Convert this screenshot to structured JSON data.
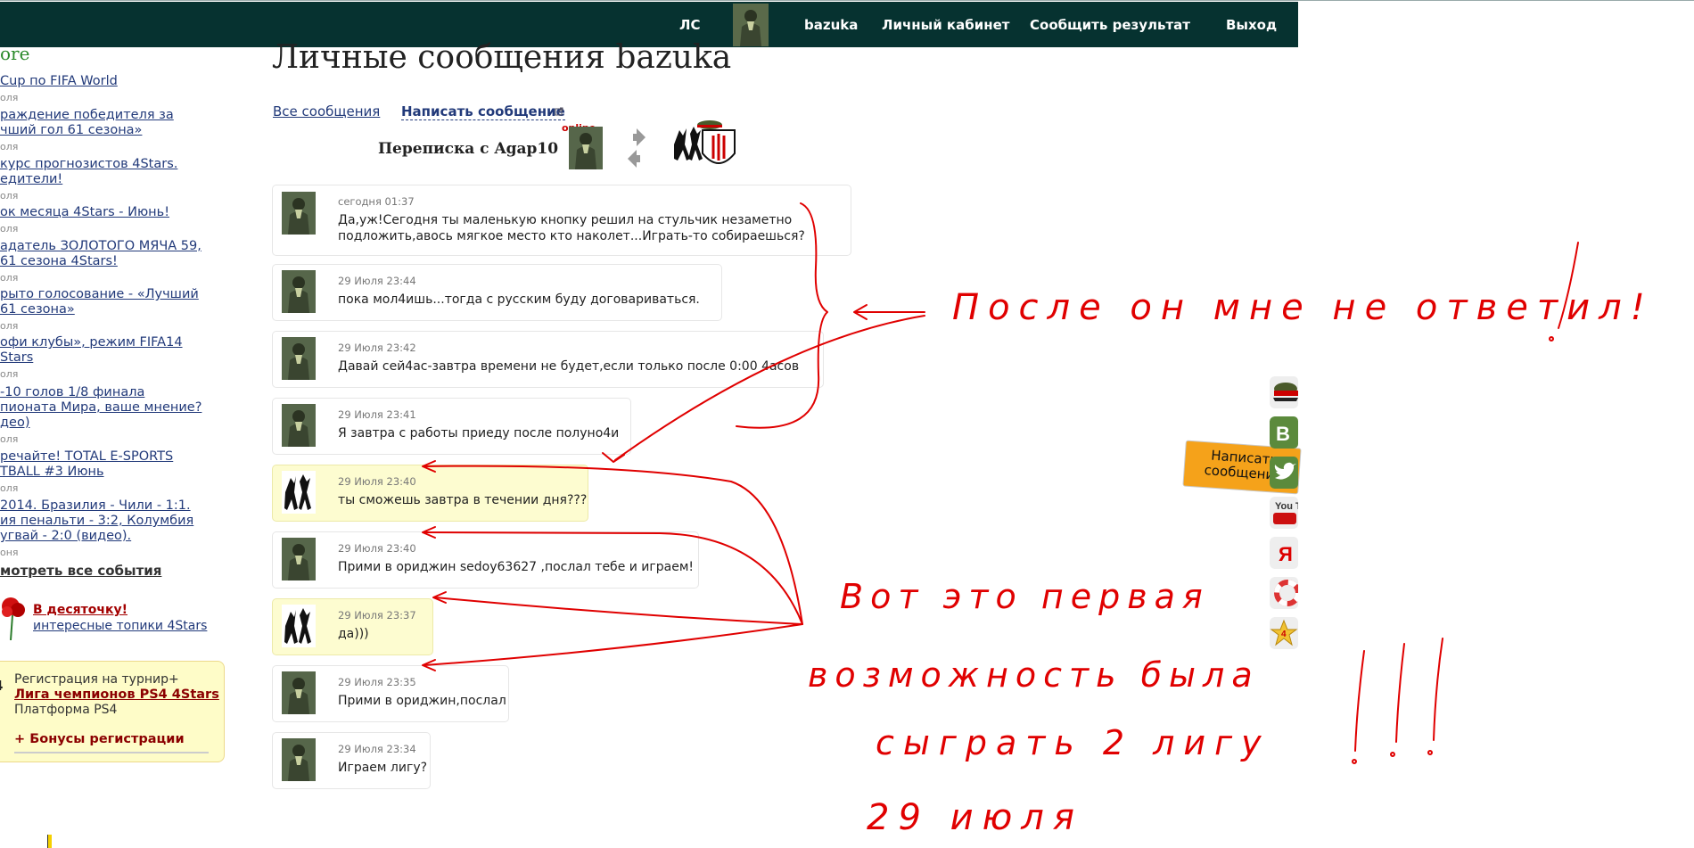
{
  "nav": {
    "ls": "ЛС",
    "user": "bazuka",
    "cabinet": "Личный кабинет",
    "report": "Сообщить результат",
    "logout": "Выход"
  },
  "sidebar": {
    "heading": "ore",
    "events": [
      {
        "title": " Cup по FIFA World",
        "date": "оля"
      },
      {
        "title": "раждение победителя за",
        "title2": "чший гол 61 сезона»",
        "date": "оля"
      },
      {
        "title": "курс прогнозистов 4Stars.",
        "title2": "едители!",
        "date": "оля"
      },
      {
        "title": "ок месяца 4Stars - Июнь!",
        "date": "оля"
      },
      {
        "title": "адатель ЗОЛОТОГО МЯЧА 59,",
        "title2": " 61 сезона 4Stars!",
        "date": "оля"
      },
      {
        "title": "рыто голосование - «Лучший",
        "title2": " 61 сезона»",
        "date": "оля"
      },
      {
        "title": "офи клубы», режим FIFA14",
        "title2": "Stars",
        "date": "оля"
      },
      {
        "title": "-10 голов 1/8 финала",
        "title2": "пионата Мира, ваше мнение?",
        "title3": "део)",
        "date": "оля"
      },
      {
        "title": "речайте! TOTAL E-SPORTS",
        "title2": "TBALL #3 Июнь",
        "date": "оля"
      },
      {
        "title": "2014. Бразилия - Чили - 1:1.",
        "title2": "ия пенальти - 3:2, Колумбия",
        "title3": "угвай - 2:0 (видео).",
        "date": "оня"
      }
    ],
    "see_all": "мотреть все события",
    "top10_title": "В десяточку!",
    "top10_sub": "интересные топики 4Stars",
    "reg": {
      "edge": "4",
      "line1": "Регистрация на турнир+",
      "line2": "Лига чемпионов PS4 4Stars",
      "line3": "Платформа PS4",
      "line4": "+ Бонусы регистрации"
    }
  },
  "main": {
    "title": "Личные сообщения bazuka",
    "all_messages": "Все сообщения",
    "write_message": "Написать сообщение",
    "conversation_title": "Переписка с Agap10",
    "online": "online"
  },
  "messages": [
    {
      "time": "сегодня 01:37",
      "lines": [
        "Да,уж!Сегодня ты маленькую кнопку решил на стульчик незаметно",
        "подложить,авось мягкое место кто наколет...Играть-то собираешься?"
      ],
      "avatar": "soldier"
    },
    {
      "time": "29 Июля 23:44",
      "lines": [
        "пока мол4ишь...тогда с русским буду договариваться."
      ],
      "avatar": "soldier"
    },
    {
      "time": "29 Июля 23:42",
      "lines": [
        "Давай сей4ас-завтра времени не будет,если только после 0:00 4асов"
      ],
      "avatar": "soldier"
    },
    {
      "time": "29 Июля 23:41",
      "lines": [
        "Я завтра с работы приеду после полуно4и"
      ],
      "avatar": "soldier"
    },
    {
      "time": "29 Июля 23:40",
      "lines": [
        "ты сможешь завтра в течении дня???"
      ],
      "avatar": "fighters",
      "highlight": true
    },
    {
      "time": "29 Июля 23:40",
      "lines": [
        "Прими в ориджин sedoy63627 ,послал тебе и играем!"
      ],
      "avatar": "soldier"
    },
    {
      "time": "29 Июля 23:37",
      "lines": [
        "да)))"
      ],
      "avatar": "fighters",
      "highlight": true
    },
    {
      "time": "29 Июля 23:35",
      "lines": [
        "Прими в ориджин,послал"
      ],
      "avatar": "soldier"
    },
    {
      "time": "29 Июля 23:34",
      "lines": [
        "Играем лигу?"
      ],
      "avatar": "soldier"
    }
  ],
  "social": {
    "write_badge": "Написать сообщение",
    "items": [
      "cap-icon",
      "vk-icon",
      "twitter-icon",
      "youtube-icon",
      "yandex-icon",
      "lifebuoy-icon",
      "star-4-icon"
    ],
    "vk_letter": "В",
    "youtube_text": "You Tube",
    "yandex_letter": "Я",
    "star_text": "4"
  },
  "annotations": {
    "note1": "После он мне не ответил!",
    "note2_line1": "Вот это первая",
    "note2_line2": "возможность была",
    "note2_line3": "сыграть 2 лигу",
    "note2_line4": "29 июля",
    "exclaim": "!!!"
  },
  "colors": {
    "navbar": "#063230",
    "link": "#223a7a",
    "accent_red": "#a30000",
    "annotation": "#e00000",
    "highlight_bg": "#fdfcd0"
  }
}
